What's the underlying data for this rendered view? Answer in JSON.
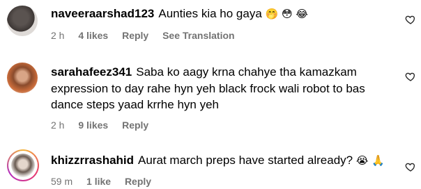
{
  "comments": [
    {
      "username": "naveeraarshad123",
      "lines": [
        "Aunties kia ho gaya"
      ],
      "emoji": "🤭 😳 😂",
      "time": "2 h",
      "likes": "4 likes",
      "reply": "Reply",
      "translate": "See Translation"
    },
    {
      "username": "sarahafeez341",
      "lines": [
        "Saba ko aagy krna chahye tha kamazkam",
        "expression to day rahe hyn yeh black frock wali robot to bas",
        "dance steps yaad krrhe hyn yeh"
      ],
      "time": "2 h",
      "likes": "9 likes",
      "reply": "Reply"
    },
    {
      "username": "khizzrrashahid",
      "lines": [
        "Aurat march preps have started already?"
      ],
      "emoji": "😭 🙏",
      "time": "59 m",
      "likes": "1 like",
      "reply": "Reply"
    }
  ]
}
